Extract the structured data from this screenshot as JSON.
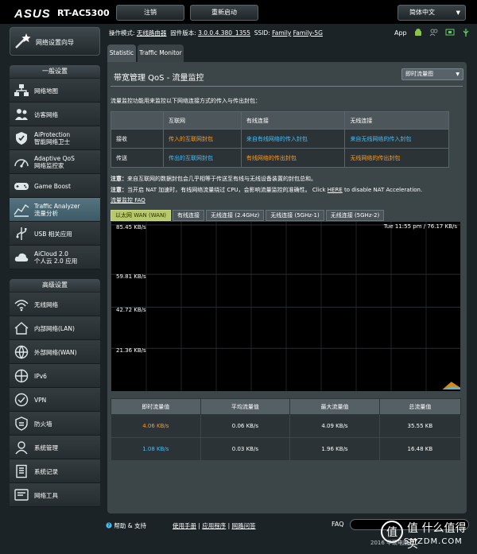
{
  "header": {
    "brand": "ASUS",
    "model": "RT-AC5300",
    "logout_label": "注销",
    "reboot_label": "重新启动",
    "language_label": "简体中文"
  },
  "sidebar": {
    "wizard_label": "网络设置向导",
    "general_title": "一般设置",
    "general_items": [
      {
        "label": "网络地图",
        "icon": "network-map-icon"
      },
      {
        "label": "访客网络",
        "icon": "guest-network-icon"
      },
      {
        "label": "AiProtection",
        "label2": "智能网络卫士",
        "icon": "aiprotection-icon"
      },
      {
        "label": "Adaptive QoS",
        "label2": "网络监控家",
        "icon": "qos-icon"
      },
      {
        "label": "Game Boost",
        "icon": "gamepad-icon"
      },
      {
        "label": "Traffic Analyzer",
        "label2": "流量分析",
        "icon": "traffic-analyzer-icon"
      },
      {
        "label": "USB 相关应用",
        "icon": "usb-icon"
      },
      {
        "label": "AiCloud 2.0",
        "label2": "个人云 2.0 应用",
        "icon": "cloud-icon"
      }
    ],
    "advanced_title": "高级设置",
    "advanced_items": [
      {
        "label": "无线网络",
        "icon": "wifi-icon"
      },
      {
        "label": "内部网络(LAN)",
        "icon": "home-icon"
      },
      {
        "label": "外部网络(WAN)",
        "icon": "globe-icon"
      },
      {
        "label": "IPv6",
        "icon": "ipv6-icon"
      },
      {
        "label": "VPN",
        "icon": "vpn-icon"
      },
      {
        "label": "防火墙",
        "icon": "firewall-icon"
      },
      {
        "label": "系统管理",
        "icon": "admin-icon"
      },
      {
        "label": "系统记录",
        "icon": "log-icon"
      },
      {
        "label": "网络工具",
        "icon": "tools-icon"
      }
    ]
  },
  "info": {
    "mode_label": "操作模式:",
    "mode_value": "无线路由器",
    "firmware_label": "固件版本:",
    "firmware_value": "3.0.0.4.380_1355",
    "ssid_label": "SSID:",
    "ssid_1": "Family",
    "ssid_2": "Family-5G",
    "app_label": "App"
  },
  "tabs": [
    "Statistic",
    "Traffic Monitor"
  ],
  "panel": {
    "title": "带宽管理 QoS - 流量监控",
    "select_value": "即时流量图",
    "description": "流量监控功能用来监控以下网络连接方式的传入与传出封包：",
    "table_headers": [
      "",
      "互联网",
      "有线连接",
      "无线连接"
    ],
    "table_rows": [
      {
        "label": "接收",
        "internet": "传入的互联网封包",
        "wired": "来自有线网络的传入封包",
        "wireless": "来自无线网络的传入封包"
      },
      {
        "label": "传送",
        "internet": "传出的互联网封包",
        "wired": "有线网络的传出封包",
        "wireless": "无线网络的传出封包"
      }
    ],
    "note1_prefix": "注意：",
    "note1_text": "来自互联网的数据封包会几乎相等于传送至有线与无线设备装置的封包总和。",
    "note2_prefix": "注意：",
    "note2_text": "当开启 NAT 加速时，有线网络流量绕过 CPU，会影响流量监控的准确性。 Click ",
    "note2_link": "HERE",
    "note2_suffix": " to disable NAT Acceleration.",
    "faq_link": "流量监控 FAQ"
  },
  "chart_tabs": [
    "以太网 WAN (WAN)",
    "有线连接",
    "无线连接 (2.4GHz)",
    "无线连接 (5GHz-1)",
    "无线连接 (5GHz-2)"
  ],
  "chart_data": {
    "type": "area",
    "ytick_labels": [
      "85.45 KB/s",
      "59.81 KB/s",
      "42.72 KB/s",
      "21.36 KB/s"
    ],
    "ytick_values": [
      85.45,
      59.81,
      42.72,
      21.36
    ],
    "ylim": [
      0,
      85.45
    ],
    "time_label": "Tue 11:55 pm / 76.17 KB/s",
    "grid": true,
    "series": [
      {
        "color": "#f7a11a",
        "values": [
          0,
          0,
          0,
          0,
          0,
          0,
          0,
          0,
          0,
          0,
          0,
          0,
          0,
          0,
          0,
          0,
          0,
          0,
          0,
          0,
          0,
          0,
          0,
          0,
          0,
          0,
          0,
          0,
          0,
          0,
          0,
          0,
          0,
          0,
          0,
          0,
          0,
          0,
          4,
          1
        ]
      },
      {
        "color": "#49bdf8",
        "values": [
          0,
          0,
          0,
          0,
          0,
          0,
          0,
          0,
          0,
          0,
          0,
          0,
          0,
          0,
          0,
          0,
          0,
          0,
          0,
          0,
          0,
          0,
          0,
          0,
          0,
          0,
          0,
          0,
          0,
          0,
          0,
          0,
          0,
          0,
          0,
          0,
          0,
          0,
          1.5,
          1
        ]
      }
    ]
  },
  "stats": {
    "headers": [
      "即时流量值",
      "平均流量值",
      "最大流量值",
      "总流量值"
    ],
    "rows": [
      {
        "current": "4.06 KB/s",
        "average": "0.06 KB/s",
        "max": "4.09 KB/s",
        "total": "35.55 KB",
        "color": "#ff9b1e"
      },
      {
        "current": "1.08 KB/s",
        "average": "0.03 KB/s",
        "max": "1.96 KB/s",
        "total": "16.48 KB",
        "color": "#49bdf8"
      }
    ]
  },
  "footer": {
    "help": "帮助 & 支持",
    "links": [
      "使用手册",
      "应用程序",
      "网路问答"
    ],
    "faq": "FAQ",
    "copyright": "2016 华硕电脑",
    "watermark_1": "值 什么值得买",
    "watermark_2": "SMZDM.COM"
  }
}
